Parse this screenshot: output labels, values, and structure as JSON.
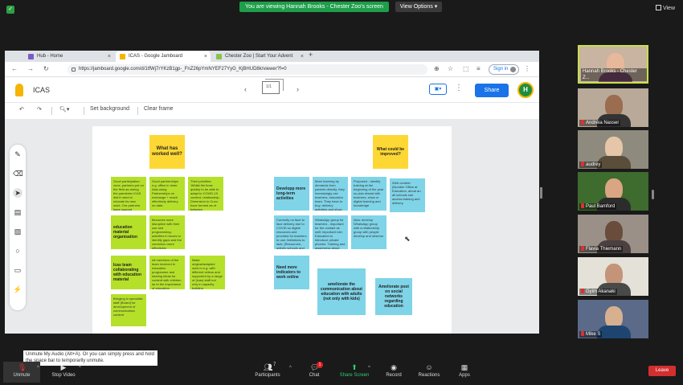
{
  "zoom": {
    "banner": "You are viewing Hannah Brooks - Chester Zoo's screen",
    "view_options": "View Options ▾",
    "view_label": "View"
  },
  "browser": {
    "tabs": [
      {
        "label": "Hub - Home",
        "color": "#7b5cc4"
      },
      {
        "label": "ICAS - Google Jamboard",
        "color": "#f5b400"
      },
      {
        "label": "Chester Zoo | Start Your Advent",
        "color": "#8bc34a"
      }
    ],
    "new_tab": "+",
    "url": "https://jamboard.google.com/d/1tfWj7rYKzB1gp-_FnZ26pYmNYEF27YyG_KjBHUD8k/viewer?f=0",
    "signin": "Sign in"
  },
  "jamboard": {
    "title": "ICAS",
    "frame_count": "1/1",
    "share_label": "Share",
    "avatar_letter": "H",
    "toolbar": {
      "set_background": "Set background",
      "clear_frame": "Clear frame"
    },
    "notes": [
      {
        "id": "n1",
        "color": "y",
        "style": "big",
        "text": "What has worked well?"
      },
      {
        "id": "n2",
        "color": "y",
        "style": "midc",
        "text": "What could be improved?"
      },
      {
        "id": "n3",
        "color": "g",
        "style": "small",
        "text": "Good participation: zone, partners put on the field as during the pandemic ICAS didn't need to relocate its new work. Our partners have support unavailable."
      },
      {
        "id": "n4",
        "color": "g",
        "style": "small",
        "text": "Good partnerships e.g. office in Inner Asia using Partnerships on exchange + reach effectively delivery on data"
      },
      {
        "id": "n5",
        "color": "g",
        "style": "small",
        "text": "Their priorities: 'Whilst the lines quickly to be able to adapt to COVID-19 context, relationship. Dimension to Cuvu have formed as of between departments field for questions time."
      },
      {
        "id": "n6",
        "color": "g",
        "style": "mid",
        "text": "education material organisation"
      },
      {
        "id": "n7",
        "color": "g",
        "style": "small",
        "text": "Becomes more disruptive with their use and programming: activities it moves to identify gaps and the correction more effectively"
      },
      {
        "id": "n8",
        "color": "g",
        "style": "mid",
        "text": "Icas team collaborating with education material"
      },
      {
        "id": "n9",
        "color": "g",
        "style": "small",
        "text": "All members of the team involved in education programme and sharing ideas for content with children as to the importance of education"
      },
      {
        "id": "n10",
        "color": "g",
        "style": "small",
        "text": "Make original/adapted work in e.g. with different videos and supported by a range of (Icas) staff not only in capacity building"
      },
      {
        "id": "n11",
        "color": "g",
        "style": "small",
        "text": "Bringing in specialist staff (Board) for development of communication content"
      },
      {
        "id": "n12",
        "color": "b",
        "style": "mid",
        "text": "Developp more long-term activities"
      },
      {
        "id": "n13",
        "color": "b",
        "style": "small",
        "text": "More learning by demands from parents directly; they increasingly use teachers, education team. They have to buy; delivery activities and show concept to carry them."
      },
      {
        "id": "n14",
        "color": "b",
        "style": "small",
        "text": "Proposed - identify training at the beginning of the year so plan ahead with teachers; show or digital learning and knowledge."
      },
      {
        "id": "n15",
        "color": "b",
        "style": "small",
        "text": "Web content: (Number Office at Education, about an all schools can access training and delivery"
      },
      {
        "id": "n16",
        "color": "b",
        "style": "small",
        "text": "Currently no face to face delivery due to COVID so digital resources and provided for teachers to use; limitations to lack: (Resources; activity schools and teachers."
      },
      {
        "id": "n17",
        "color": "b",
        "style": "small",
        "text": "WhatsApp group for teachers - important for the contact as well; important role: Education to introduce private phones. Training and awareness about wellbeing."
      },
      {
        "id": "n18",
        "color": "b",
        "style": "small",
        "text": "Idea: develop WhatsApp group with a relationship group with people develop and observe"
      },
      {
        "id": "n19",
        "color": "b",
        "style": "mid",
        "text": "Need more indicators to work online"
      },
      {
        "id": "n20",
        "color": "b",
        "style": "midc",
        "text": "ameliorate the communication about education with adults (not only with kids)"
      },
      {
        "id": "n21",
        "color": "b",
        "style": "midc",
        "text": "Ameliorate post on social networks regarding education"
      }
    ]
  },
  "participants": [
    {
      "name": "Hannah Brooks - Chester Z...",
      "bg": "#c8b4a0",
      "face": "#e8b89a",
      "body": "#7a4d6e",
      "muted": false,
      "active": true
    },
    {
      "name": "Andréia Nasser",
      "bg": "#b8a998",
      "face": "#9a6d50",
      "body": "#333333",
      "muted": true,
      "active": false
    },
    {
      "name": "audrey",
      "bg": "#8e8a7e",
      "face": "#e6c6a8",
      "body": "#5a4d3a",
      "muted": true,
      "active": false
    },
    {
      "name": "Paul Bamford",
      "bg": "#3e6b2e",
      "face": "#d9a582",
      "body": "#2c2c2c",
      "muted": true,
      "active": false
    },
    {
      "name": "Flavia Thiemann",
      "bg": "#9a9088",
      "face": "#6a4c3c",
      "body": "#4a4040",
      "muted": true,
      "active": false
    },
    {
      "name": "Gyim Akanaki",
      "bg": "#e4e1d8",
      "face": "#c49478",
      "body": "#494949",
      "muted": true,
      "active": false
    },
    {
      "name": "Mike S",
      "bg": "#5a6a88",
      "face": "#d7b090",
      "body": "#1d4570",
      "muted": true,
      "active": false
    }
  ],
  "tooltip": "Unmute My Audio (Alt+A). Or you can simply press and hold the space bar to temporarily unmute.",
  "controls": {
    "unmute": "Unmute",
    "stop_video": "Stop Video",
    "participants": "Participants",
    "participants_count": "7",
    "chat": "Chat",
    "chat_badge": "1",
    "share_screen": "Share Screen",
    "record": "Record",
    "reactions": "Reactions",
    "apps": "Apps",
    "leave": "Leave"
  }
}
